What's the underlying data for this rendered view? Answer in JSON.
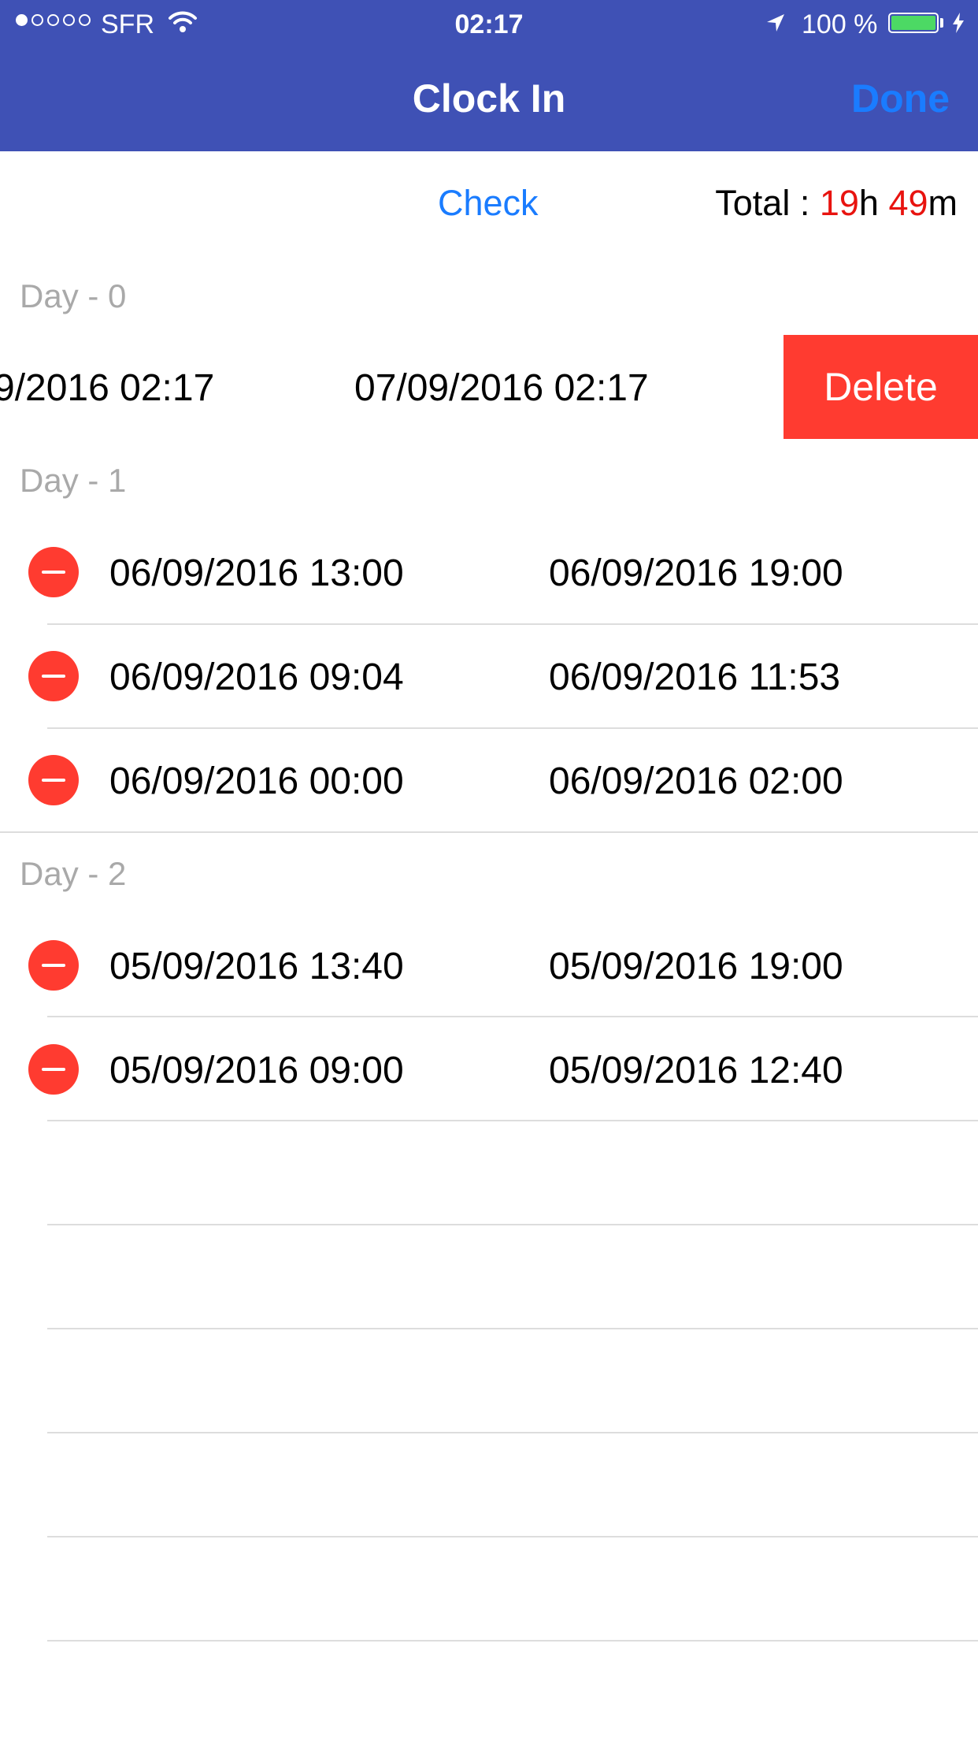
{
  "status_bar": {
    "carrier": "SFR",
    "time": "02:17",
    "battery_percent": "100 %",
    "battery_level": 1.0,
    "signal_bars_filled": 1,
    "signal_bars_total": 5
  },
  "nav": {
    "title": "Clock In",
    "done_label": "Done"
  },
  "header": {
    "check_label": "Check",
    "total_label": "Total : ",
    "total_hours": "19",
    "hours_unit": "h ",
    "total_minutes": "49",
    "minutes_unit": "m"
  },
  "sections": [
    {
      "title": "Day - 0",
      "rows": [
        {
          "start": "9/2016 02:17",
          "end": "07/09/2016 02:17",
          "swiped": true,
          "delete_label": "Delete"
        }
      ]
    },
    {
      "title": "Day - 1",
      "rows": [
        {
          "start": "06/09/2016 13:00",
          "end": "06/09/2016 19:00"
        },
        {
          "start": "06/09/2016 09:04",
          "end": "06/09/2016 11:53"
        },
        {
          "start": "06/09/2016 00:00",
          "end": "06/09/2016 02:00"
        }
      ]
    },
    {
      "title": "Day - 2",
      "rows": [
        {
          "start": "05/09/2016 13:40",
          "end": "05/09/2016 19:00"
        },
        {
          "start": "05/09/2016 09:00",
          "end": "05/09/2016 12:40"
        }
      ]
    }
  ],
  "colors": {
    "nav_background": "#3f51b5",
    "accent_blue": "#1a7cff",
    "delete_red": "#ff3b30",
    "total_red": "#e8130f",
    "section_gray": "#a9a9a9"
  }
}
